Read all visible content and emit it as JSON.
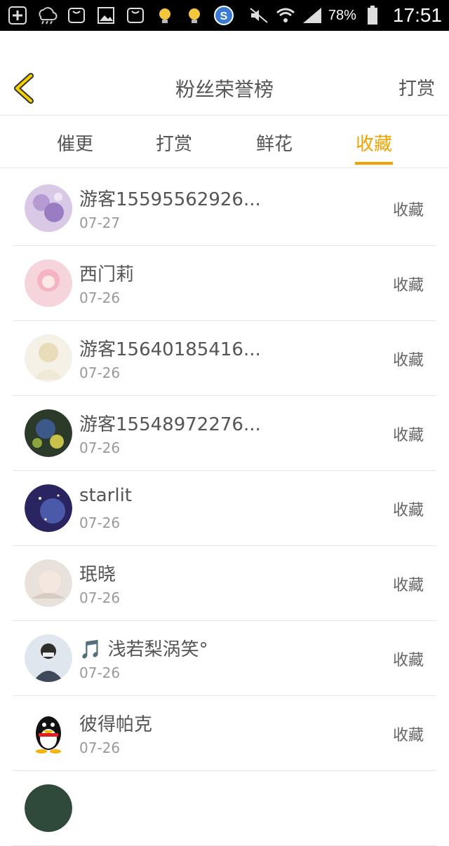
{
  "status_bar": {
    "battery": "78%",
    "time": "17:51",
    "icons": [
      "plus-icon",
      "rain-cloud-icon",
      "square-icon",
      "image-icon",
      "square-icon",
      "bulb-icon",
      "bulb-icon",
      "s-app-icon",
      "mute-icon",
      "wifi-icon",
      "signal-icon",
      "battery-icon"
    ]
  },
  "header": {
    "title": "粉丝荣誉榜",
    "right_action": "打赏"
  },
  "tabs": [
    {
      "label": "催更"
    },
    {
      "label": "打赏"
    },
    {
      "label": "鲜花"
    },
    {
      "label": "收藏"
    }
  ],
  "active_tab": "收藏",
  "rows": [
    {
      "name": "游客15595562926...",
      "date": "07-27",
      "action": "收藏"
    },
    {
      "name": "西门莉",
      "date": "07-26",
      "action": "收藏"
    },
    {
      "name": "游客15640185416...",
      "date": "07-26",
      "action": "收藏"
    },
    {
      "name": "游客15548972276...",
      "date": "07-26",
      "action": "收藏"
    },
    {
      "name": "starlit",
      "date": "07-26",
      "action": "收藏"
    },
    {
      "name": "珉晓",
      "date": "07-26",
      "action": "收藏"
    },
    {
      "name": "🎵 浅若梨涡笑°",
      "date": "07-26",
      "action": "收藏"
    },
    {
      "name": "彼得帕克",
      "date": "07-26",
      "action": "收藏"
    },
    {
      "name": "",
      "date": "",
      "action": ""
    }
  ],
  "colors": {
    "accent": "#f0a200",
    "status_bar_bg": "#000000",
    "divider": "#e6e6e6"
  }
}
